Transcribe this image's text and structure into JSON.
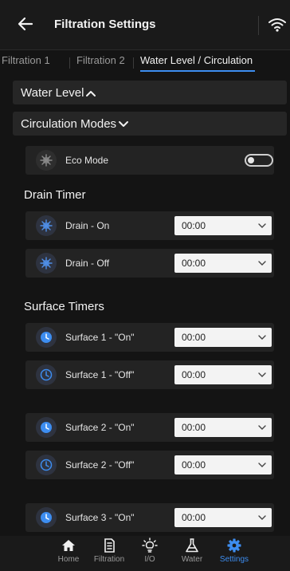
{
  "header": {
    "title": "Filtration Settings"
  },
  "tabs": [
    {
      "label": "Filtration 1"
    },
    {
      "label": "Filtration 2"
    },
    {
      "label": "Water Level / Circulation"
    }
  ],
  "accordions": {
    "water_level": "Water Level",
    "circulation_modes": "Circulation Modes"
  },
  "eco_mode": {
    "label": "Eco Mode",
    "enabled": false
  },
  "sections": {
    "drain_timer": "Drain Timer",
    "surface_timers": "Surface Timers"
  },
  "timers": [
    {
      "label": "Drain - On",
      "value": "00:00",
      "icon": "snowflake-icon"
    },
    {
      "label": "Drain - Off",
      "value": "00:00",
      "icon": "snowflake-icon"
    },
    {
      "label": "Surface 1 - \"On\"",
      "value": "00:00",
      "icon": "clock-filled-icon"
    },
    {
      "label": "Surface 1 - \"Off\"",
      "value": "00:00",
      "icon": "clock-outline-icon"
    },
    {
      "label": "Surface 2 - \"On\"",
      "value": "00:00",
      "icon": "clock-filled-icon"
    },
    {
      "label": "Surface 2 - \"Off\"",
      "value": "00:00",
      "icon": "clock-outline-icon"
    },
    {
      "label": "Surface 3 - \"On\"",
      "value": "00:00",
      "icon": "clock-filled-icon"
    }
  ],
  "nav": [
    {
      "label": "Home",
      "icon": "home-icon"
    },
    {
      "label": "Filtration",
      "icon": "filtration-icon"
    },
    {
      "label": "I/O",
      "icon": "lightbulb-icon"
    },
    {
      "label": "Water",
      "icon": "flask-icon"
    },
    {
      "label": "Settings",
      "icon": "gear-icon",
      "active": true
    }
  ],
  "colors": {
    "accent": "#3d8df0",
    "background": "#141414",
    "card": "#232323"
  }
}
